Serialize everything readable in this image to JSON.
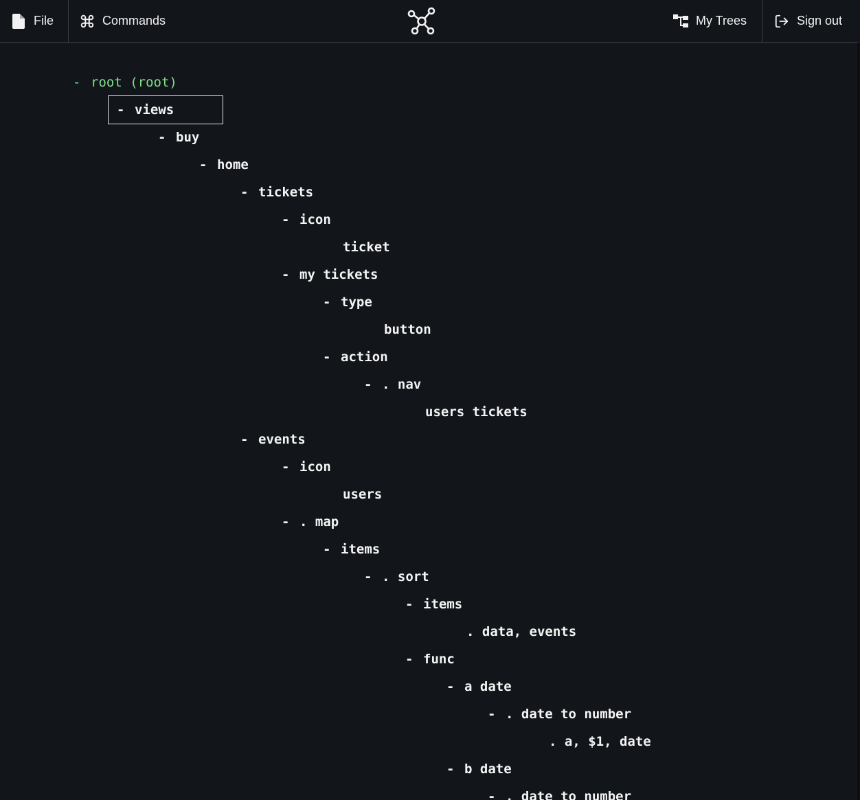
{
  "toolbar": {
    "file_label": "File",
    "commands_label": "Commands",
    "my_trees_label": "My Trees",
    "sign_out_label": "Sign out",
    "icons": {
      "file": "file-icon",
      "commands": "command-icon",
      "logo": "network-graph-icon",
      "my_trees": "tree-icon",
      "sign_out": "sign-out-icon"
    }
  },
  "colors": {
    "background": "#12151a",
    "root_text": "#7ee08a",
    "node_text": "#f4f4f4"
  },
  "tree": {
    "root": {
      "dash": "-",
      "label": "root (root)"
    },
    "nodes": [
      {
        "dash": "-",
        "label": "views",
        "selected": true
      },
      {
        "dash": "-",
        "label": "buy"
      },
      {
        "dash": "-",
        "label": "home"
      },
      {
        "dash": "-",
        "label": "tickets"
      },
      {
        "dash": "-",
        "label": "icon"
      },
      {
        "dash": "",
        "label": "ticket"
      },
      {
        "dash": "-",
        "label": "my tickets"
      },
      {
        "dash": "-",
        "label": "type"
      },
      {
        "dash": "",
        "label": "button"
      },
      {
        "dash": "-",
        "label": "action"
      },
      {
        "dash": "-",
        "label": ". nav"
      },
      {
        "dash": "",
        "label": "users tickets"
      },
      {
        "dash": "-",
        "label": "events"
      },
      {
        "dash": "-",
        "label": "icon"
      },
      {
        "dash": "",
        "label": "users"
      },
      {
        "dash": "-",
        "label": ". map"
      },
      {
        "dash": "-",
        "label": "items"
      },
      {
        "dash": "-",
        "label": ". sort"
      },
      {
        "dash": "-",
        "label": "items"
      },
      {
        "dash": "",
        "label": ". data, events"
      },
      {
        "dash": "-",
        "label": "func"
      },
      {
        "dash": "-",
        "label": "a date"
      },
      {
        "dash": "-",
        "label": ". date to number"
      },
      {
        "dash": "",
        "label": ". a, $1, date"
      },
      {
        "dash": "-",
        "label": "b date"
      },
      {
        "dash": "-",
        "label": ". date to number"
      }
    ]
  }
}
